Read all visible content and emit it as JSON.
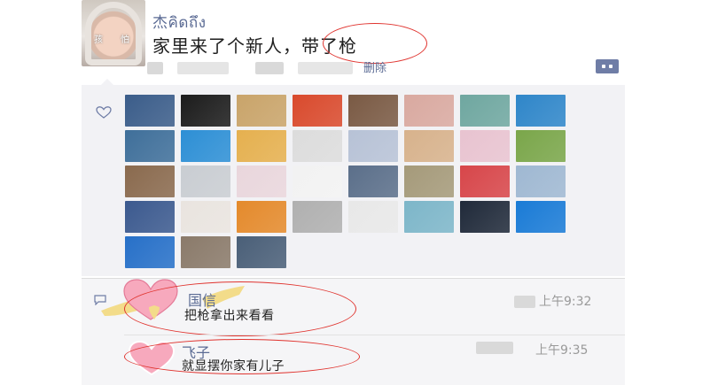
{
  "post": {
    "username": "杰คิดถึง",
    "text": "家里来了个新人，带了枪",
    "avatar_tags": [
      "孩",
      "怕"
    ],
    "delete_label": "删除"
  },
  "likers": [
    "#3b5d8a",
    "#1c1c1c",
    "#c9a46a",
    "#d94a2d",
    "#7a5a44",
    "#d9a9a0",
    "#6fa7a0",
    "#2f86c9",
    "#3f6f9a",
    "#2d8fd5",
    "#e5b04f",
    "#dcdcdc",
    "#b7c2d6",
    "#d7b28c",
    "#e8c3d0",
    "#7aa64a",
    "#8a6a4e",
    "#c9cdd2",
    "#e9d6dc",
    "#f2f2f2",
    "#5b6f8a",
    "#a59a7a",
    "#d7464a",
    "#9fb8d2",
    "#3c5a8f",
    "#e9e4df",
    "#e48a2c",
    "#b0b0b0",
    "#e8e8e8",
    "#7db6c9",
    "#202a3a",
    "#1a7bd6",
    "#2770c8",
    "#8a7a6a",
    "#4a5f78"
  ],
  "comments": [
    {
      "name": "国信",
      "text": "把枪拿出来看看",
      "time": "上午9:32"
    },
    {
      "name": "飞子",
      "text": "就显摆你家有儿子",
      "time": "上午9:35"
    }
  ],
  "icons": [
    "heart-icon",
    "comment-icon",
    "more-icon"
  ]
}
